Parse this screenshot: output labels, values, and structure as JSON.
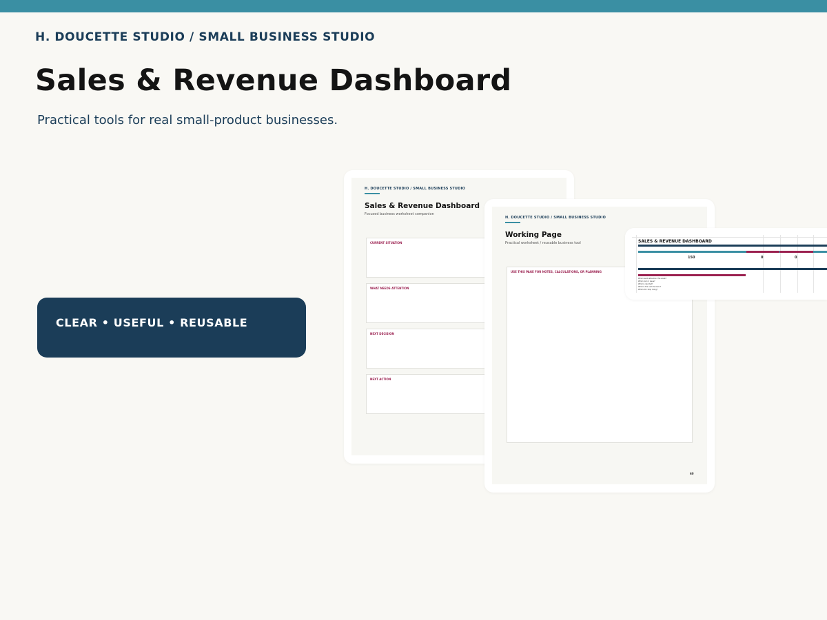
{
  "header": {
    "brand": "H. DOUCETTE STUDIO / SMALL BUSINESS STUDIO",
    "title": "Sales & Revenue Dashboard",
    "subtitle": "Practical tools for real small-product businesses."
  },
  "tagline": "CLEAR • USEFUL • REUSABLE",
  "preview_dashboard": {
    "brand": "H. DOUCETTE STUDIO / SMALL BUSINESS STUDIO",
    "title": "Sales & Revenue Dashboard",
    "subtitle": "Focused business worksheet companion",
    "sections": [
      "CURRENT SITUATION",
      "WHAT NEEDS ATTENTION",
      "NEXT DECISION",
      "NEXT ACTION"
    ]
  },
  "preview_working": {
    "brand": "H. DOUCETTE STUDIO / SMALL BUSINESS STUDIO",
    "title": "Working Page",
    "subtitle": "Practical worksheet / reusable business tool",
    "box_label": "USE THIS PAGE FOR NOTES, CALCULATIONS, OR PLANNING",
    "page_number": "60"
  },
  "preview_spreadsheet": {
    "title": "SALES & REVENUE DASHBOARD",
    "values": [
      "150",
      "0",
      "0"
    ],
    "questions": [
      "What needs attention this week?",
      "What cost or issue?",
      "What is decided?",
      "What is the next decision?",
      "What am I stop doing?"
    ]
  },
  "colors": {
    "accent": "#3a8fa3",
    "navy": "#1b3d58",
    "magenta": "#9b2150",
    "background": "#f9f8f4"
  }
}
